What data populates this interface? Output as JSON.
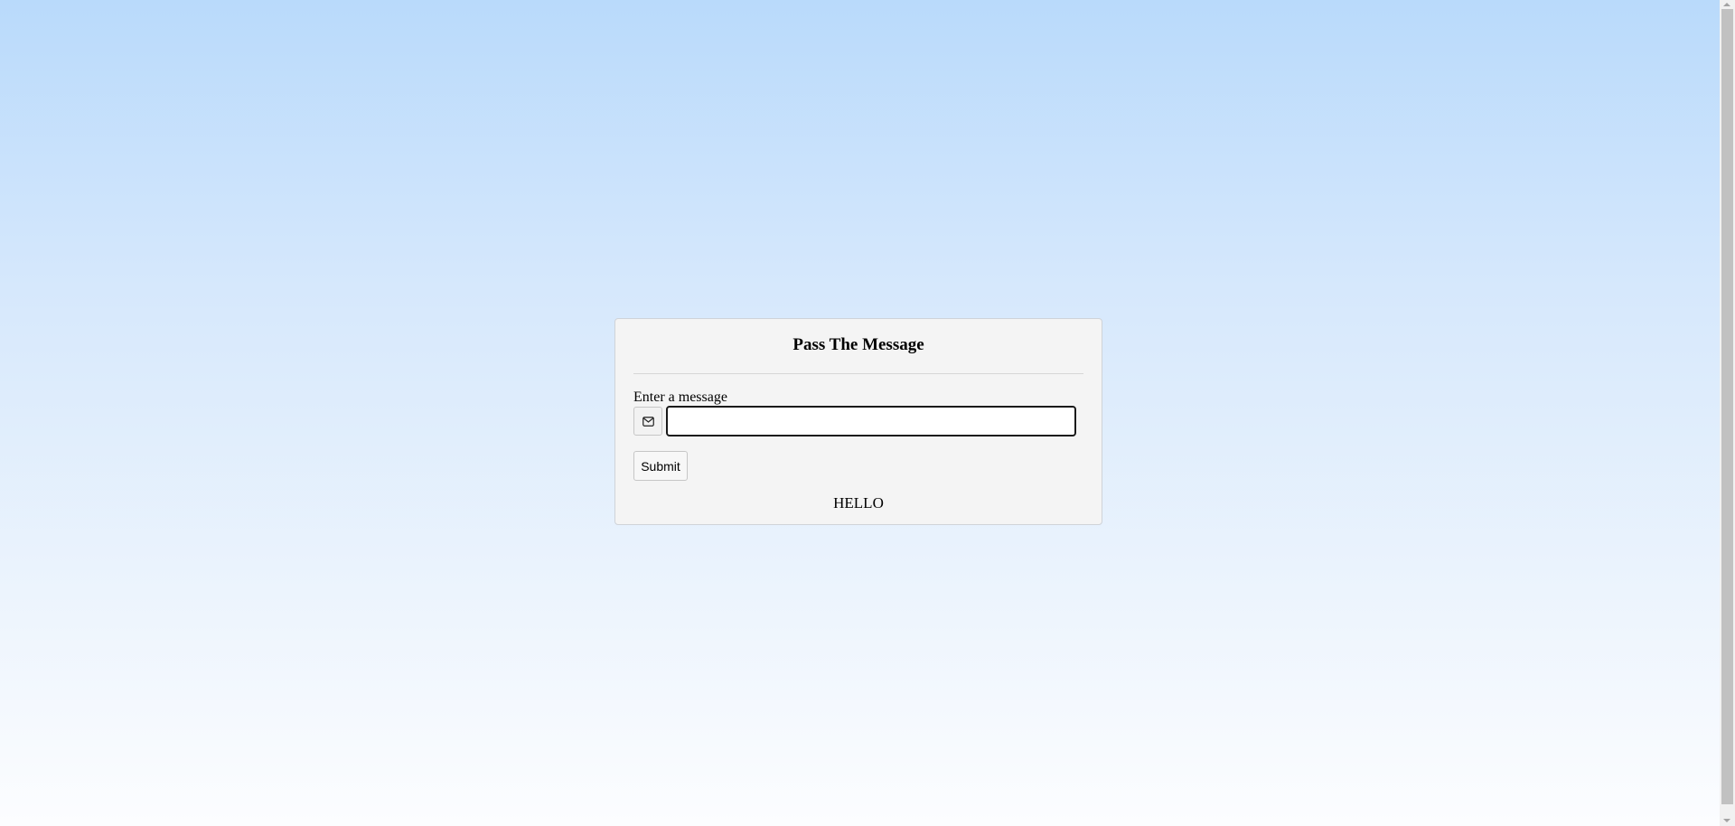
{
  "card": {
    "title": "Pass The Message",
    "field_label": "Enter a message",
    "input_icon": "envelope-icon",
    "input_value": "",
    "input_placeholder": "",
    "submit_label": "Submit",
    "output_text": "HELLO"
  },
  "colors": {
    "background_top": "#b9dafb",
    "background_bottom": "#fcfdff",
    "card_background": "#f4f4f4",
    "card_border": "#cfd3d8"
  }
}
